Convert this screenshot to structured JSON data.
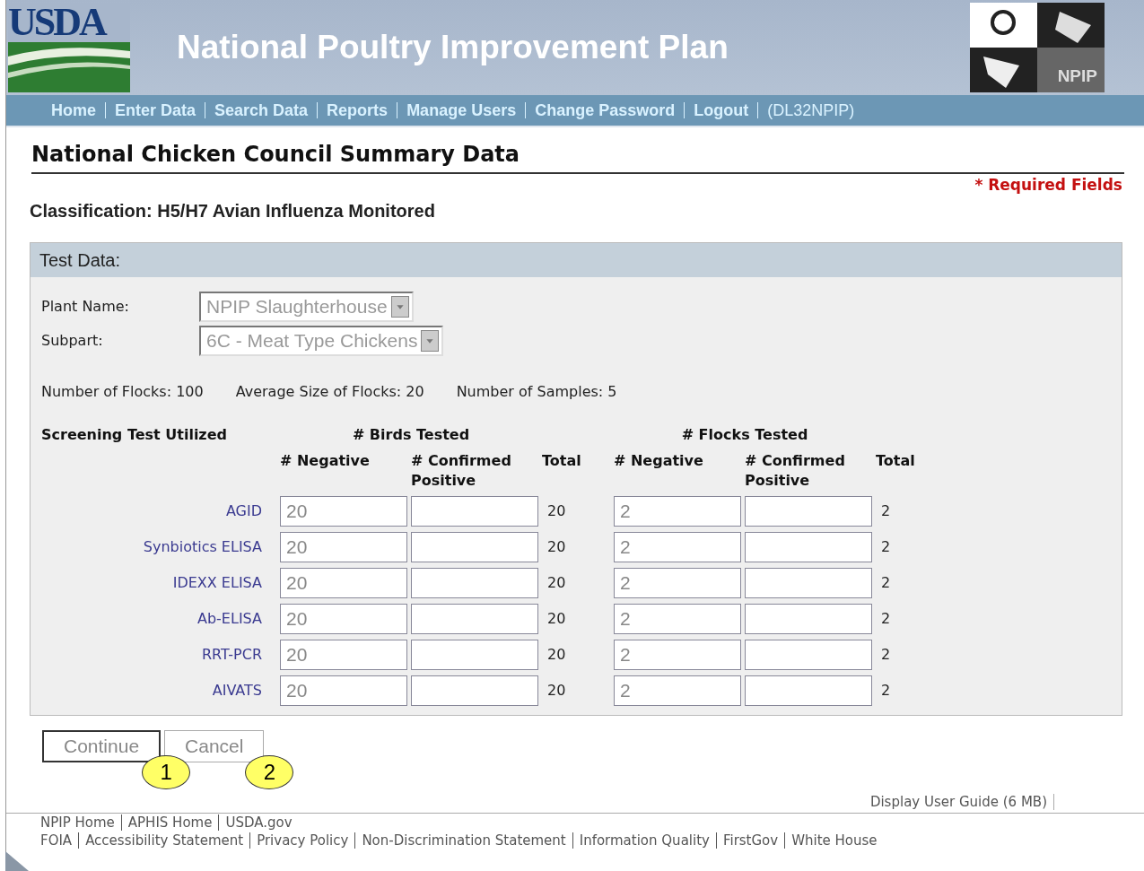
{
  "header": {
    "logo": "USDA",
    "title": "National Poultry Improvement Plan",
    "badge": "NPIP"
  },
  "nav": {
    "links": [
      {
        "label": "Home"
      },
      {
        "label": "Enter Data"
      },
      {
        "label": "Search Data"
      },
      {
        "label": "Reports"
      },
      {
        "label": "Manage Users"
      },
      {
        "label": "Change Password"
      },
      {
        "label": "Logout"
      }
    ],
    "user": "(DL32NPIP)"
  },
  "page_title": "National Chicken Council Summary Data",
  "required_note": {
    "mark": "*",
    "text": "Required Fields"
  },
  "classification": "Classification: H5/H7 Avian Influenza Monitored",
  "panel": {
    "title": "Test Data:",
    "selects": [
      {
        "label": "Plant Name:",
        "value": "NPIP Slaughterhouse",
        "disabled": true
      },
      {
        "label": "Subpart:",
        "value": "6C - Meat Type Chickens",
        "disabled": true
      }
    ],
    "stats": [
      "Number of Flocks: 100",
      "Average Size of Flocks: 20",
      "Number of Samples: 5"
    ],
    "table": {
      "row_header": "Screening Test Utilized",
      "groups": [
        "# Birds Tested",
        "# Flocks Tested"
      ],
      "columns": [
        "# Negative",
        "# Confirmed Positive",
        "Total",
        "# Negative",
        "# Confirmed Positive",
        "Total"
      ],
      "rows": [
        {
          "test": "AGID",
          "birds_negative": "20",
          "birds_total": "20",
          "flocks_negative": "2",
          "flocks_total": "2"
        },
        {
          "test": "Synbiotics ELISA",
          "birds_negative": "20",
          "birds_total": "20",
          "flocks_negative": "2",
          "flocks_total": "2"
        },
        {
          "test": "IDEXX ELISA",
          "birds_negative": "20",
          "birds_total": "20",
          "flocks_negative": "2",
          "flocks_total": "2"
        },
        {
          "test": "Ab-ELISA",
          "birds_negative": "20",
          "birds_total": "20",
          "flocks_negative": "2",
          "flocks_total": "2"
        },
        {
          "test": "RRT-PCR",
          "birds_negative": "20",
          "birds_total": "20",
          "flocks_negative": "2",
          "flocks_total": "2"
        },
        {
          "test": "AIVATS",
          "birds_negative": "20",
          "birds_total": "20",
          "flocks_negative": "2",
          "flocks_total": "2"
        }
      ]
    }
  },
  "buttons": [
    {
      "label": "Continue",
      "selected": true,
      "callout": "1"
    },
    {
      "label": "Cancel",
      "selected": false,
      "callout": "2"
    }
  ],
  "user_guide": "Display User Guide (6 MB)",
  "footer": {
    "line_1": [
      "NPIP Home",
      "APHIS Home",
      "USDA.gov"
    ],
    "line_2": [
      "FOIA",
      "Accessibility Statement",
      "Privacy Policy",
      "Non-Discrimination Statement",
      "Information Quality",
      "FirstGov",
      "White House"
    ]
  }
}
